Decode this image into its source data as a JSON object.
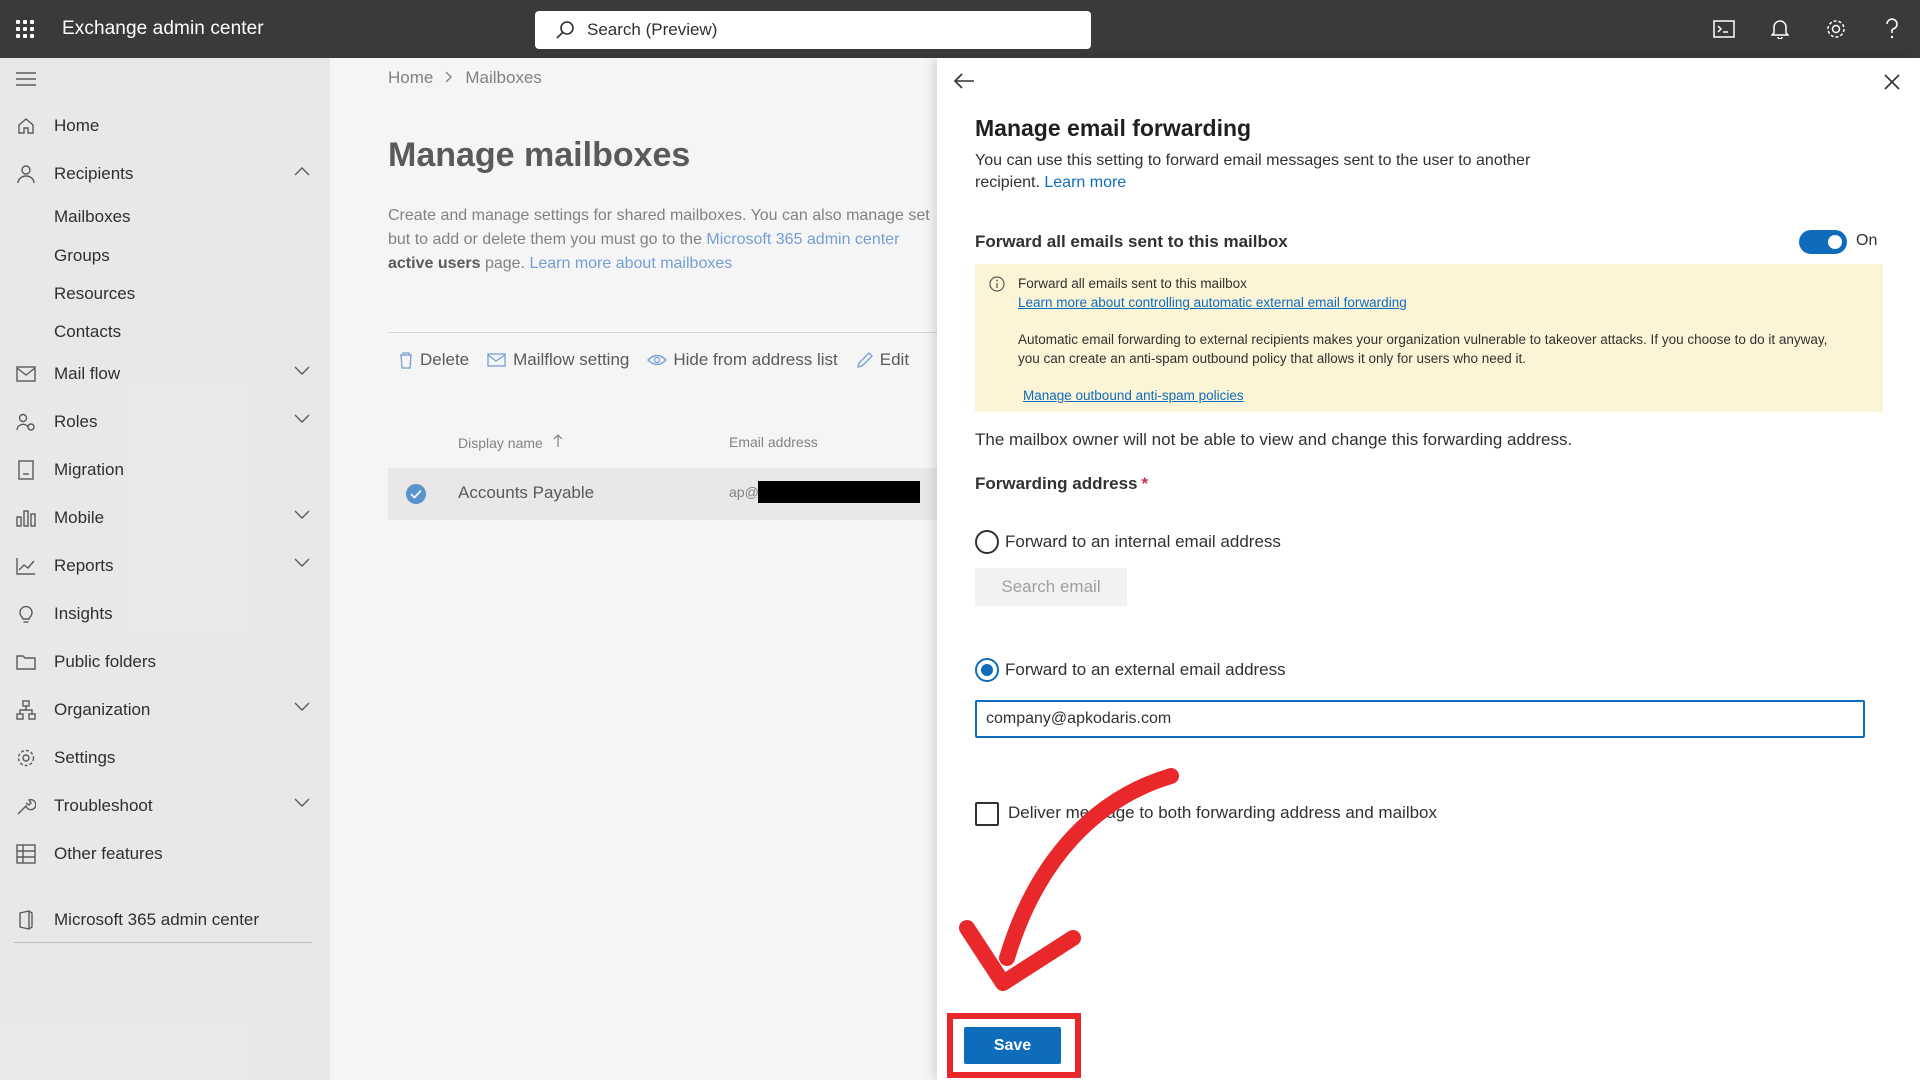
{
  "topbar": {
    "app_title": "Exchange admin center",
    "search_placeholder": "Search (Preview)"
  },
  "nav": {
    "items": [
      {
        "label": "Home",
        "icon": "home-icon"
      },
      {
        "label": "Recipients",
        "icon": "person-icon",
        "expanded": true
      },
      {
        "label": "Mail flow",
        "icon": "mail-icon"
      },
      {
        "label": "Roles",
        "icon": "roles-icon"
      },
      {
        "label": "Migration",
        "icon": "migration-icon"
      },
      {
        "label": "Mobile",
        "icon": "mobile-icon"
      },
      {
        "label": "Reports",
        "icon": "chart-icon"
      },
      {
        "label": "Insights",
        "icon": "lightbulb-icon"
      },
      {
        "label": "Public folders",
        "icon": "folder-icon"
      },
      {
        "label": "Organization",
        "icon": "org-icon"
      },
      {
        "label": "Settings",
        "icon": "gear-icon"
      },
      {
        "label": "Troubleshoot",
        "icon": "wrench-icon"
      },
      {
        "label": "Other features",
        "icon": "grid-icon"
      },
      {
        "label": "Microsoft 365 admin center",
        "icon": "office-icon"
      }
    ],
    "subitems": [
      "Mailboxes",
      "Groups",
      "Resources",
      "Contacts"
    ]
  },
  "main": {
    "breadcrumb": [
      "Home",
      "Mailboxes"
    ],
    "title": "Manage mailboxes",
    "desc_1": "Create and manage settings for shared mailboxes. You can also manage set",
    "desc_2": "but to add or delete them you must go to the ",
    "desc_link_1": "Microsoft 365 admin center",
    "desc_bold": "active users",
    "desc_3": " page. ",
    "desc_link_2": "Learn more about mailboxes",
    "toolbar": [
      "Delete",
      "Mailflow setting",
      "Hide from address list",
      "Edit"
    ],
    "columns": [
      "Display name",
      "Email address"
    ],
    "row": {
      "name": "Accounts Payable",
      "email": "ap@"
    }
  },
  "panel": {
    "title": "Manage email forwarding",
    "desc": "You can use this setting to forward email messages sent to the user to another recipient.",
    "desc_link": "Learn more",
    "forward_all_label": "Forward all emails sent to this mailbox",
    "toggle_state": "On",
    "warning": {
      "line1": "Forward all emails sent to this mailbox",
      "link1": "Learn more about controlling automatic external email forwarding",
      "body": "Automatic email forwarding to external recipients makes your organization vulnerable to takeover attacks. If you choose to do it anyway, you can create an anti-spam outbound policy that allows it only for users who need it.",
      "link2": "Manage outbound anti-spam policies"
    },
    "owner_note": "The mailbox owner will not be able to view and change this forwarding address.",
    "forwarding_address_label": "Forwarding address",
    "required_mark": "*",
    "radio_internal": "Forward to an internal email address",
    "search_email": "Search email",
    "radio_external": "Forward to an external email address",
    "external_value": "company@apkodaris.com",
    "deliver_label": "Deliver message to both forwarding address and mailbox",
    "save": "Save"
  },
  "colors": {
    "accent": "#0f6cbd",
    "topbar": "#3b3a39",
    "highlight": "#e8282b",
    "warning_bg": "#fcf4d6"
  }
}
